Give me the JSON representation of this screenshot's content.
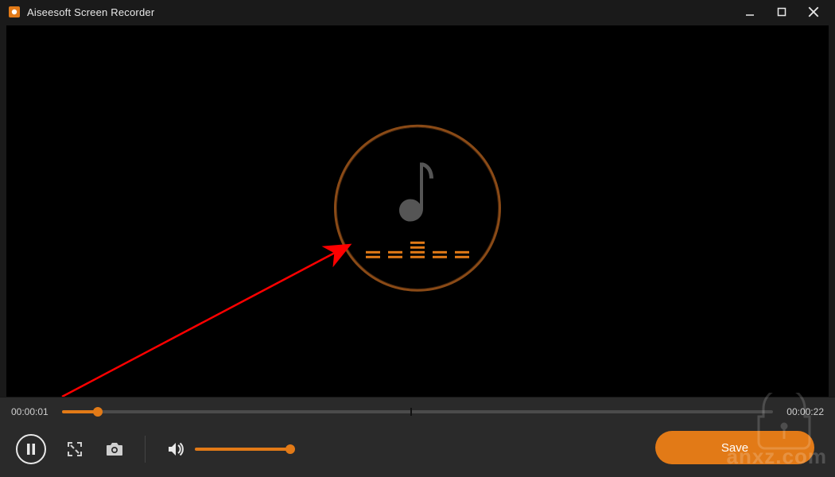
{
  "titlebar": {
    "title": "Aiseesoft Screen Recorder"
  },
  "media": {
    "visual_type": "audio-only",
    "note_icon": "music-note-icon",
    "equalizer_bars": [
      2,
      2,
      4,
      2,
      2
    ]
  },
  "playback": {
    "current_time": "00:00:01",
    "total_time": "00:00:22",
    "progress_percent": 5,
    "volume_percent": 100
  },
  "buttons": {
    "pause": "Pause",
    "fullscreen": "Fullscreen",
    "snapshot": "Snapshot",
    "volume": "Volume",
    "save_label": "Save"
  },
  "watermark": {
    "text": "anxz.com"
  },
  "colors": {
    "accent": "#e27a17",
    "accent_dark": "#8a4a16",
    "bg": "#1a1a1a",
    "panel": "#2a2a2a",
    "annotation_arrow": "#ff0000"
  }
}
